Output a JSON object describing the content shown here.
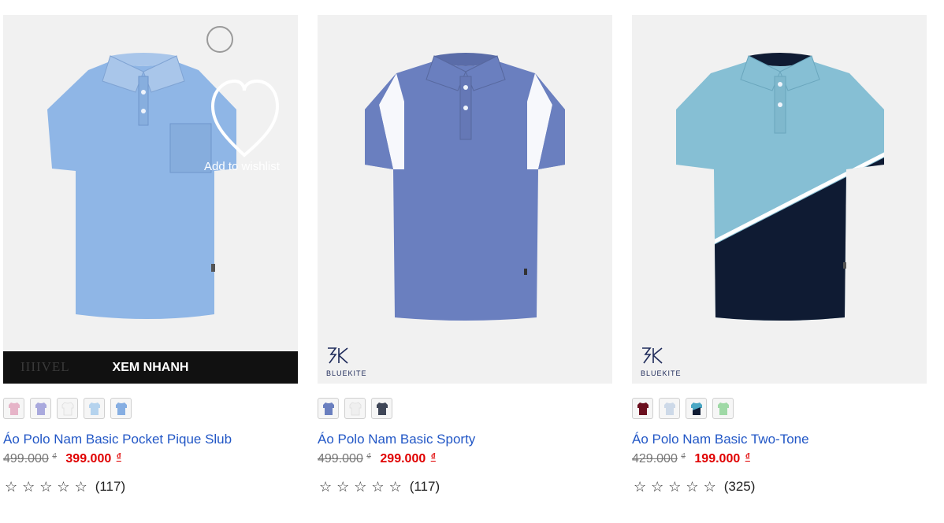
{
  "products": [
    {
      "name": "Áo Polo Nam Basic Pocket Pique Slub",
      "old_price": "499.000",
      "new_price": "399.000",
      "currency": "₫",
      "reviews": "(117)",
      "shirt_color": "#8fb6e6",
      "collar_color": "#a9c6ea",
      "swatches": [
        "#e6b4c8",
        "#a9a9dd",
        "#f4f4f4",
        "#b5d3ee",
        "#86aee2"
      ],
      "quick_view_label": "XEM NHANH",
      "quick_view_logo": "IIIIVEL",
      "wishlist_label": "Add to wishlist"
    },
    {
      "name": "Áo Polo Nam Basic Sporty",
      "old_price": "499.000",
      "new_price": "299.000",
      "currency": "₫",
      "reviews": "(117)",
      "shirt_color": "#6a7fbf",
      "collar_color": "#6a7fbf",
      "swatches": [
        "#6a7fbf",
        "#efefef",
        "#3f4657"
      ],
      "brand": "BLUEKITE"
    },
    {
      "name": "Áo Polo Nam Basic Two-Tone",
      "old_price": "429.000",
      "new_price": "199.000",
      "currency": "₫",
      "reviews": "(325)",
      "shirt_color": "#86bfd4",
      "bottom_color": "#0f1b33",
      "swatches": [
        "#6a0f1e",
        "#cdd9e8",
        "#4aa7c4",
        "#9fd9a6"
      ],
      "brand": "BLUEKITE"
    }
  ],
  "star_glyph": "☆",
  "brand_mark": "3K"
}
